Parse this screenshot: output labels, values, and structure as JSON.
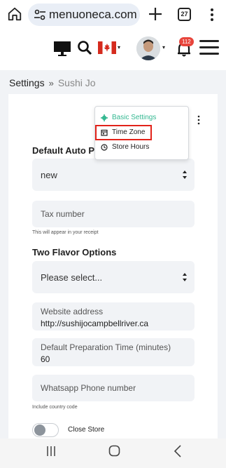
{
  "browser": {
    "url": "menuoneca.com",
    "tab_count": "27"
  },
  "header": {
    "notification_count": "112"
  },
  "breadcrumb": {
    "current": "Settings",
    "separator": "»",
    "sub": "Sushi Jo"
  },
  "dropdown": {
    "items": [
      {
        "label": "Basic Settings",
        "icon": "gear-icon"
      },
      {
        "label": "Time Zone",
        "icon": "calendar-icon"
      },
      {
        "label": "Store Hours",
        "icon": "clock-icon"
      }
    ]
  },
  "form": {
    "auto_print_label": "Default Auto Print",
    "auto_print_value": "new",
    "tax_number_placeholder": "Tax number",
    "tax_hint": "This will appear in your receipt",
    "two_flavor_label": "Two Flavor Options",
    "two_flavor_value": "Please select...",
    "website_label": "Website address",
    "website_value": "http://sushijocampbellriver.ca",
    "prep_time_label": "Default Preparation Time (minutes)",
    "prep_time_value": "60",
    "whatsapp_placeholder": "Whatsapp Phone number",
    "whatsapp_hint": "Include country code",
    "close_store_label": "Close Store"
  },
  "colors": {
    "accent": "#34b891",
    "highlight": "#e2231a",
    "badge": "#e8453c"
  }
}
